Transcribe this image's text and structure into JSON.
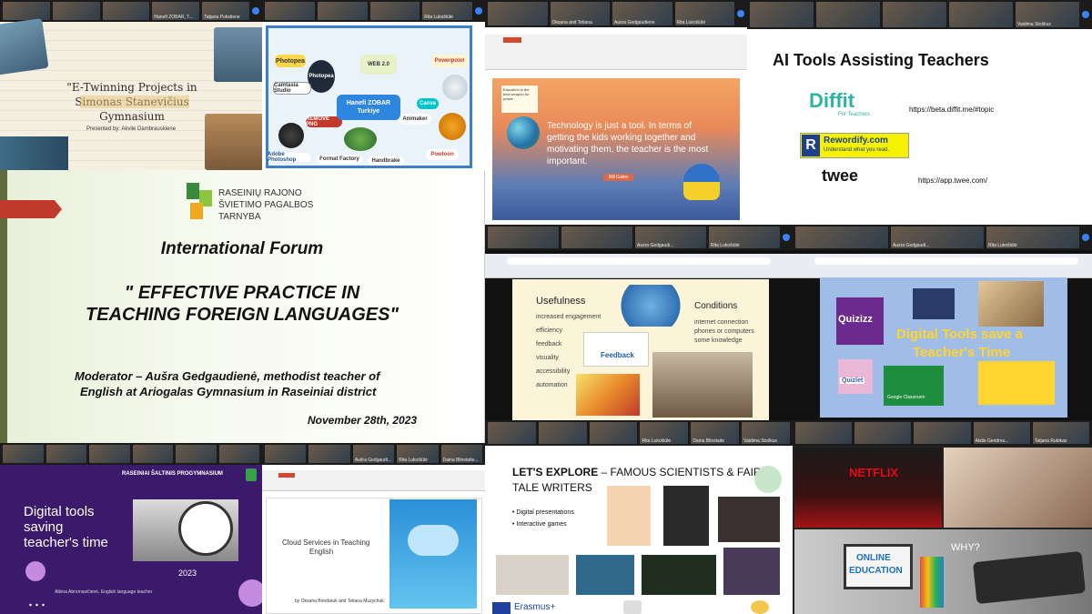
{
  "tiles": {
    "t1": {
      "participants": [
        "",
        "",
        "",
        "Hanefi ZOBAR, T...",
        "Tatjana Pukstiene"
      ],
      "title": "\"E-Twinning Projects in Simonas Stanevičius Gymnasium",
      "presenter": "Presented by: Akvile Dambrauskiene"
    },
    "t2": {
      "participants": [
        "",
        "",
        "",
        "Rita Lukošiūtė"
      ],
      "tools": [
        "Photopea",
        "Photopea",
        "WEB 2.0",
        "Powerpoint",
        "Camtasia Studio",
        "REMOVE PNG",
        "Canva",
        "Animaker",
        "Adobe Photoshop",
        "Format Factory",
        "Handbrake",
        "Powtoon"
      ],
      "center_label": "Hanefi ZOBAR Turkiye"
    },
    "t3": {
      "participants": [
        "",
        "Oksana and Tetiana",
        "Ausra Gedgaudiene",
        "Rita Lukošiūtė"
      ],
      "quote": "Technology is just a tool. In terms of getting the kids working together and motivating them, the teacher is the most important.",
      "author": "Bill Gates",
      "note": "Education is the best weapon for peace"
    },
    "t4": {
      "participants": [
        "",
        "",
        "",
        "",
        "Vaidima Stoškus"
      ],
      "title": "AI Tools Assisting Teachers",
      "diffit": "Diffit",
      "diffit_sub": "For Teachers",
      "diffit_url": "https://beta.diffit.me/#topic",
      "rewordify": "Rewordify.com",
      "rewordify_sub": "Understand what you read.",
      "twee": "twee",
      "twee_url": "https://app.twee.com/"
    },
    "t5": {
      "logo_line1": "RASEINIŲ RAJONO",
      "logo_line2": "ŠVIETIMO PAGALBOS",
      "logo_line3": "TARNYBA",
      "forum": "International Forum",
      "title1": "\" EFFECTIVE PRACTICE IN",
      "title2": "TEACHING FOREIGN LANGUAGES\"",
      "moderator1": "Moderator – Aušra Gedgaudienė, methodist teacher of",
      "moderator2": "English at Ariogalas Gymnasium in Raseiniai district",
      "date": "November 28th, 2023"
    },
    "t6": {
      "participants": [
        "",
        "",
        "Ausra Gedgaudi...",
        "Rita Lukošiūtė"
      ],
      "usefulness": "Usefulness",
      "items": [
        "increased engagement",
        "efficiency",
        "feedback",
        "visuality",
        "accessibility",
        "automation"
      ],
      "conditions": "Conditions",
      "conditions_items": [
        "internet connection",
        "phones or computers",
        "some knowledge"
      ],
      "feedback_label": "Feedback"
    },
    "t7": {
      "participants": [
        "",
        "Ausra Gedgaudi...",
        "Rita Lukošiūtė"
      ],
      "quizizz": "Quizizz",
      "headline1": "Digital Tools save a",
      "headline2": "Teacher's Time",
      "quizlet": "Quizlet",
      "classroom": "Google Classroom"
    },
    "t8": {
      "participants": [
        "",
        "",
        "",
        "",
        "",
        ""
      ],
      "school": "RASEINIAI ŠALTINIS PROGYMNASIUM",
      "title1": "Digital tools",
      "title2": "saving",
      "title3": "teacher's time",
      "year": "2023",
      "author": "Albina Abromavičienė, English language teacher"
    },
    "t9": {
      "participants": [
        "",
        "",
        "Aušra Gedgaudi...",
        "Rita Lukošiūtė",
        "Daina Blinstaite..."
      ],
      "title1": "Cloud Services in Teaching",
      "title2": "English",
      "authors": "by Oksana Bondaruk and Tetiana Muzychuk"
    },
    "t10": {
      "participants": [
        "",
        "",
        "",
        "Rita Lukošiūtė",
        "Daina Blinstaite",
        "Vaidima Stoškus"
      ],
      "headline_bold": "LET'S EXPLORE",
      "headline_rest": " – FAMOUS SCIENTISTS & FAIRY",
      "headline2": "TALE WRITERS",
      "bullet1": "Digital presentations",
      "bullet2": "Interactive games",
      "erasmus": "Erasmus+"
    },
    "t11": {
      "participants": [
        "",
        "",
        "",
        "Aistis Gendreu...",
        "Tatjana Rubikas"
      ],
      "netflix": "NETFLIX",
      "why": "WHY?",
      "online1": "ONLINE",
      "online2": "EDUCATION"
    }
  },
  "colors": {
    "forum_red": "#c0392b",
    "diffit_teal": "#2bb3a3",
    "purple_slide": "#3b1a6b",
    "quizizz": "#6c2a8c"
  }
}
